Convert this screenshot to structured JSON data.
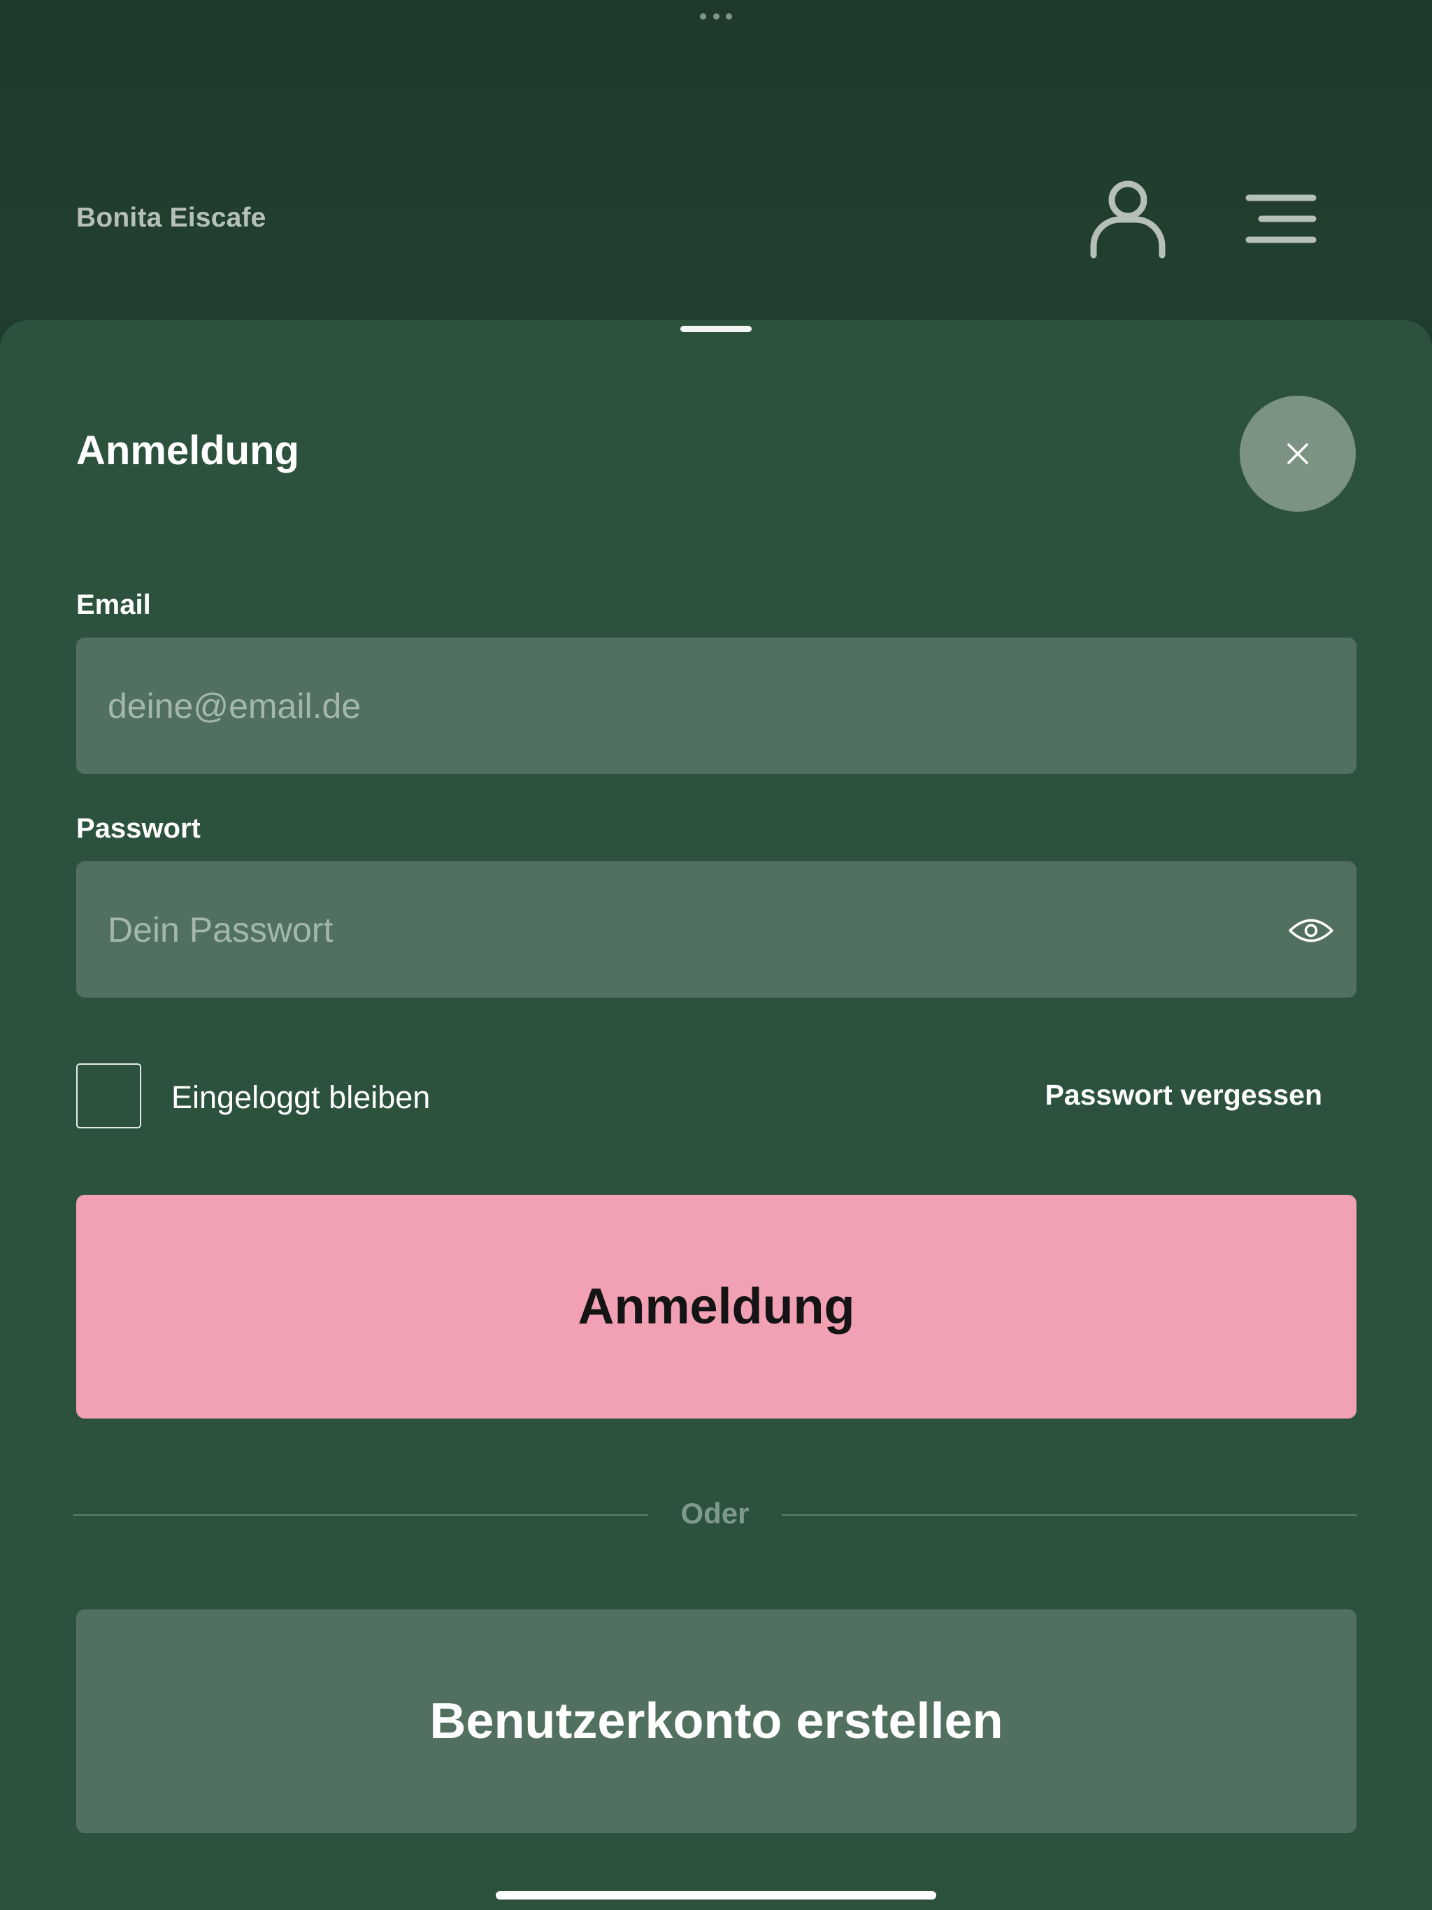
{
  "app": {
    "brand": "Bonita Eiscafe"
  },
  "header": {
    "icons": {
      "user": "user-icon",
      "menu": "menu-icon",
      "more": "more-dots-icon"
    }
  },
  "login_sheet": {
    "title": "Anmeldung",
    "close_icon": "close-icon",
    "email": {
      "label": "Email",
      "value": "",
      "placeholder": "deine@email.de"
    },
    "password": {
      "label": "Passwort",
      "value": "",
      "placeholder": "Dein Passwort",
      "toggle_icon": "eye-icon"
    },
    "remember_me": {
      "label": "Eingeloggt bleiben",
      "checked": false
    },
    "forgot_password": "Passwort vergessen",
    "submit_label": "Anmeldung",
    "divider_text": "Oder",
    "create_account_label": "Benutzerkonto erstellen"
  },
  "colors": {
    "header_bg": "#213d2e",
    "sheet_bg": "#2c523d",
    "field_bg": "#52705f",
    "primary_button": "#f2a1b4",
    "secondary_button": "#52705f"
  }
}
